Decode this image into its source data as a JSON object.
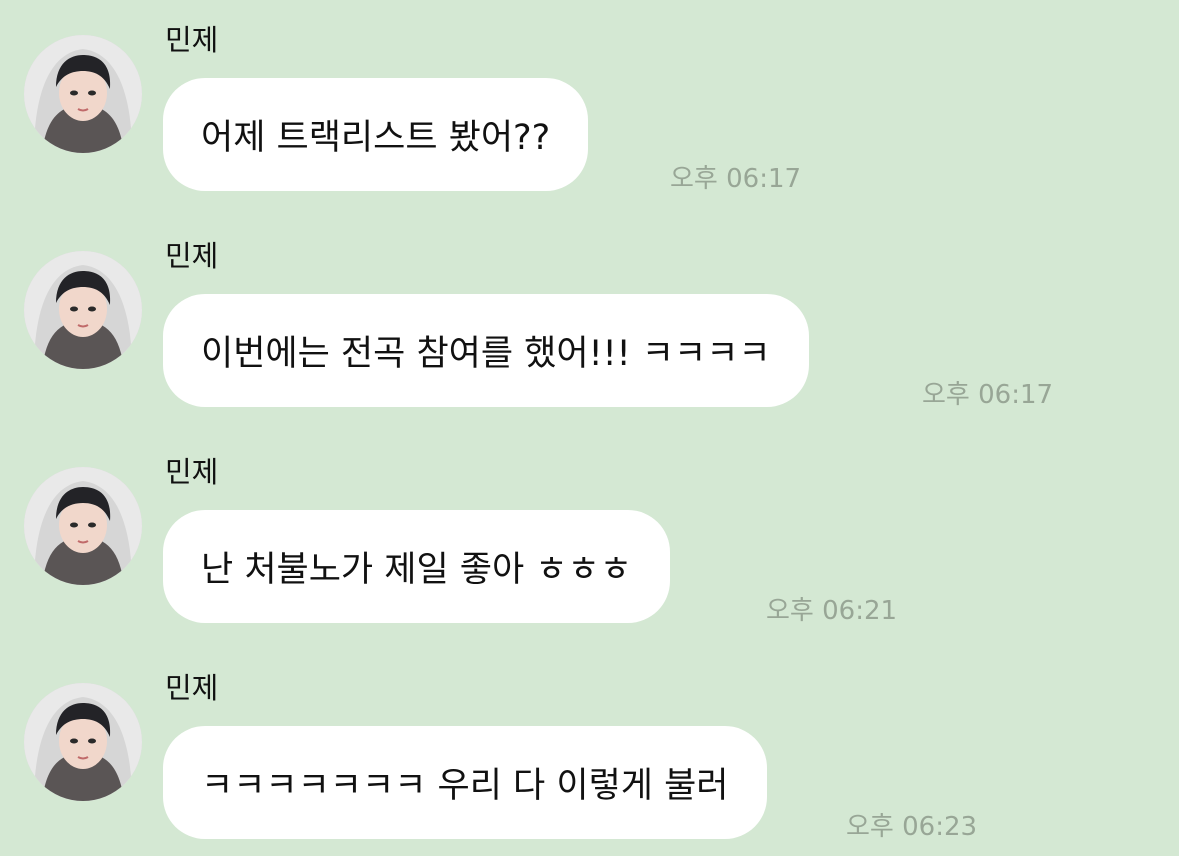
{
  "messages": [
    {
      "sender": "민제",
      "text": "어제 트랙리스트 봤어??",
      "time": "오후 06:17"
    },
    {
      "sender": "민제",
      "text": "이번에는 전곡 참여를 했어!!! ㅋㅋㅋㅋ",
      "time": "오후 06:17"
    },
    {
      "sender": "민제",
      "text": "난 처불노가 제일 좋아 ㅎㅎㅎ",
      "time": "오후 06:21"
    },
    {
      "sender": "민제",
      "text": "ㅋㅋㅋㅋㅋㅋㅋ 우리 다 이렇게 불러",
      "time": "오후 06:23"
    }
  ],
  "colors": {
    "background": "#d4e8d3",
    "bubble": "#ffffff",
    "timestamp": "#98a696"
  }
}
